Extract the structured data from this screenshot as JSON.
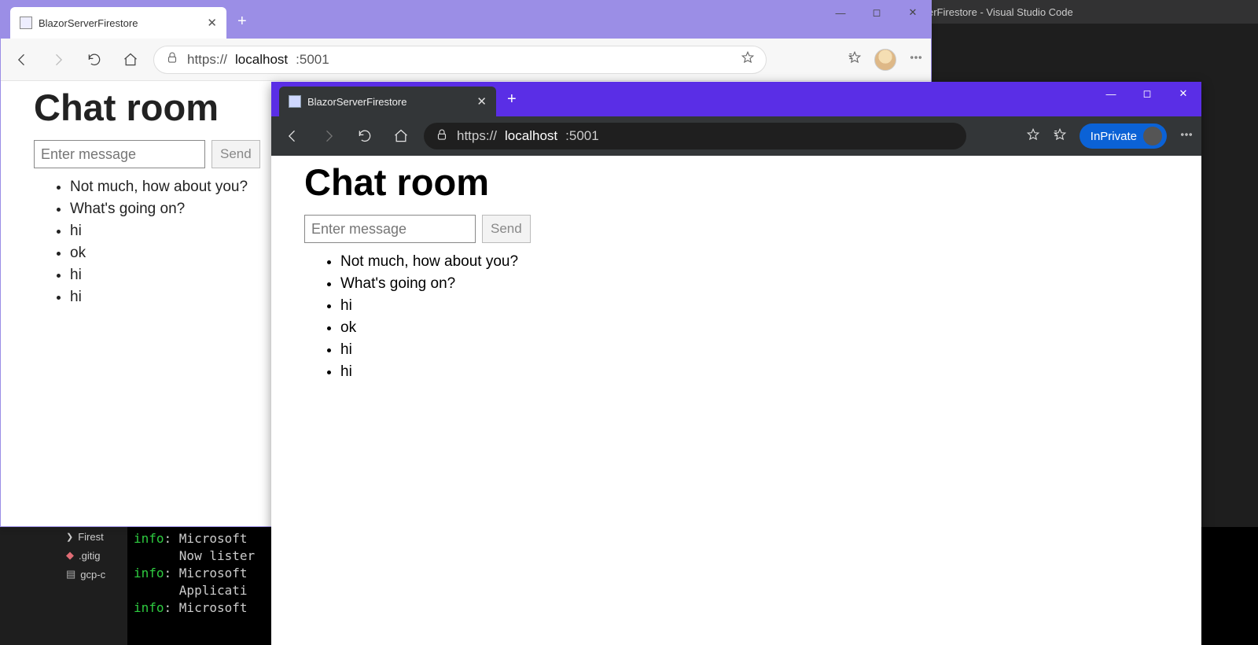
{
  "vscode": {
    "title_fragment": "erFirestore - Visual Studio Code",
    "explorer": [
      {
        "icon": "chevron",
        "label": "Firest"
      },
      {
        "icon": "git",
        "label": ".gitig"
      },
      {
        "icon": "file",
        "label": "gcp-c"
      }
    ],
    "terminal_lines": [
      {
        "prefix": "info",
        "text": ": Microsoft"
      },
      {
        "prefix": "",
        "text": "      Now lister"
      },
      {
        "prefix": "info",
        "text": ": Microsoft"
      },
      {
        "prefix": "",
        "text": "      Applicati"
      },
      {
        "prefix": "info",
        "text": ": Microsoft"
      }
    ]
  },
  "window1": {
    "tab_title": "BlazorServerFirestore",
    "url_display": {
      "scheme": "https://",
      "host": "localhost",
      "port": ":5001"
    },
    "page": {
      "heading": "Chat room",
      "placeholder": "Enter message",
      "send_label": "Send",
      "messages": [
        "Not much, how about you?",
        "What's going on?",
        "hi",
        "ok",
        "hi",
        "hi"
      ]
    }
  },
  "window2": {
    "tab_title": "BlazorServerFirestore",
    "url_display": {
      "scheme": "https://",
      "host": "localhost",
      "port": ":5001"
    },
    "inprivate_label": "InPrivate",
    "page": {
      "heading": "Chat room",
      "placeholder": "Enter message",
      "send_label": "Send",
      "messages": [
        "Not much, how about you?",
        "What's going on?",
        "hi",
        "ok",
        "hi",
        "hi"
      ]
    }
  }
}
